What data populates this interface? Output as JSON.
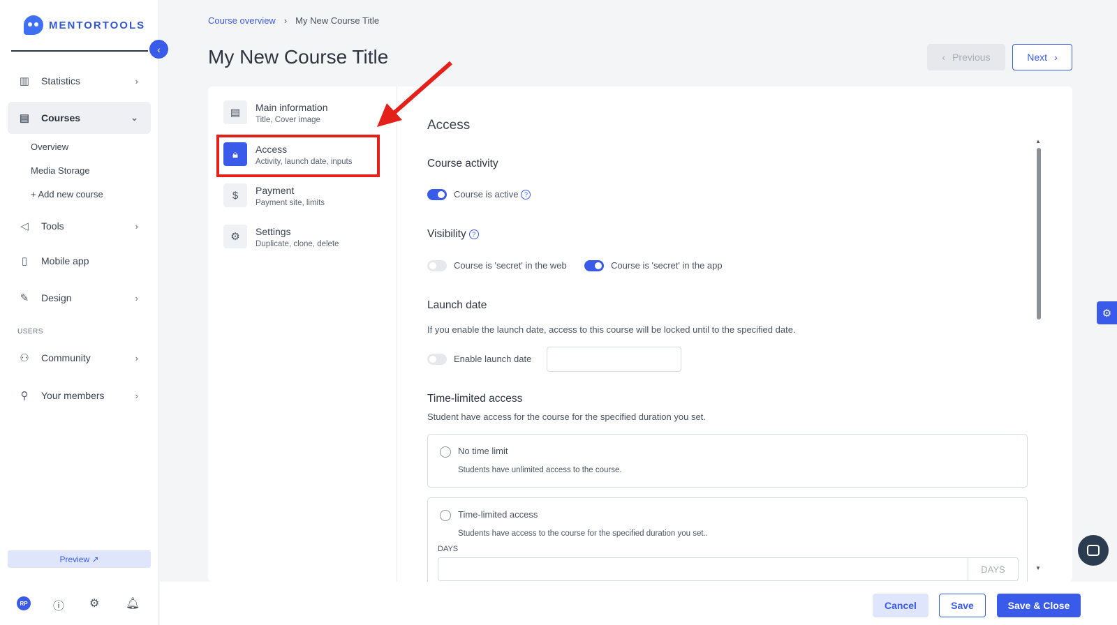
{
  "brand": {
    "name": "MENTORTOOLS"
  },
  "sidebar": {
    "items": [
      {
        "label": "Statistics",
        "icon": "bar-chart-icon"
      },
      {
        "label": "Courses",
        "icon": "book-icon"
      },
      {
        "label": "Tools",
        "icon": "megaphone-icon"
      },
      {
        "label": "Mobile app",
        "icon": "phone-icon"
      },
      {
        "label": "Design",
        "icon": "pencil-icon"
      },
      {
        "label": "Community",
        "icon": "people-icon"
      },
      {
        "label": "Your members",
        "icon": "user-icon"
      }
    ],
    "course_sub": [
      "Overview",
      "Media Storage",
      "+ Add new course"
    ],
    "users_section": "USERS",
    "preview": "Preview ↗",
    "avatar_initials": "RP"
  },
  "breadcrumb": {
    "parent": "Course overview",
    "current": "My New Course Title"
  },
  "page_title": "My New Course Title",
  "nav_buttons": {
    "previous": "Previous",
    "next": "Next"
  },
  "steps": [
    {
      "title": "Main information",
      "subtitle": "Title, Cover image",
      "icon": "document-icon"
    },
    {
      "title": "Access",
      "subtitle": "Activity, launch date, inputs",
      "icon": "lock-icon"
    },
    {
      "title": "Payment",
      "subtitle": "Payment site, limits",
      "icon": "dollar-icon"
    },
    {
      "title": "Settings",
      "subtitle": "Duplicate, clone, delete",
      "icon": "gear-icon"
    }
  ],
  "access": {
    "title": "Access",
    "course_activity": {
      "heading": "Course activity",
      "toggle_label": "Course is active",
      "active": true
    },
    "visibility": {
      "heading": "Visibility",
      "web_label": "Course is 'secret' in the web",
      "web_on": false,
      "app_label": "Course is 'secret' in the app",
      "app_on": true
    },
    "launch_date": {
      "heading": "Launch date",
      "description": "If you enable the launch date, access to this course will be locked until to the specified date.",
      "toggle_label": "Enable launch date",
      "value": ""
    },
    "time_limited": {
      "heading": "Time-limited access",
      "description": "Student have access for the course for the specified duration you set.",
      "options": [
        {
          "title": "No time limit",
          "description": "Students have unlimited access to the course."
        },
        {
          "title": "Time-limited access",
          "description": "Students have access to the course for the specified duration you set.."
        }
      ],
      "days_label": "DAYS",
      "days_suffix": "DAYS",
      "days_value": ""
    }
  },
  "footer": {
    "cancel": "Cancel",
    "save": "Save",
    "save_close": "Save & Close"
  },
  "colors": {
    "accent": "#3a5bea",
    "highlight": "#e32019"
  }
}
